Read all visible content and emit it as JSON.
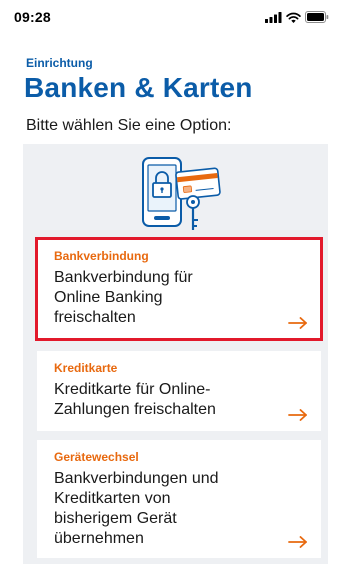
{
  "status_bar": {
    "time": "09:28"
  },
  "header": {
    "eyebrow": "Einrichtung",
    "title": "Banken & Karten",
    "subtitle": "Bitte wählen Sie eine Option:"
  },
  "illustration": {
    "icon": "phone-lock-card-key-illustration"
  },
  "options": [
    {
      "label": "Bankverbindung",
      "text_lines": [
        "Bankverbindung für",
        "Online Banking",
        "freischalten"
      ],
      "selected": true,
      "icon": "arrow-right-icon"
    },
    {
      "label": "Kreditkarte",
      "text_lines": [
        "Kreditkarte für Online-",
        "Zahlungen freischalten"
      ],
      "selected": false,
      "icon": "arrow-right-icon"
    },
    {
      "label": "Gerätewechsel",
      "text_lines": [
        "Bankverbindungen und",
        "Kreditkarten von",
        "bisherigem Gerät",
        "übernehmen"
      ],
      "selected": false,
      "icon": "arrow-right-icon"
    }
  ],
  "colors": {
    "brand_blue": "#0b5ca8",
    "accent_orange": "#e8690f",
    "highlight_red": "#e2192b",
    "panel_grey": "#eef0f3"
  }
}
